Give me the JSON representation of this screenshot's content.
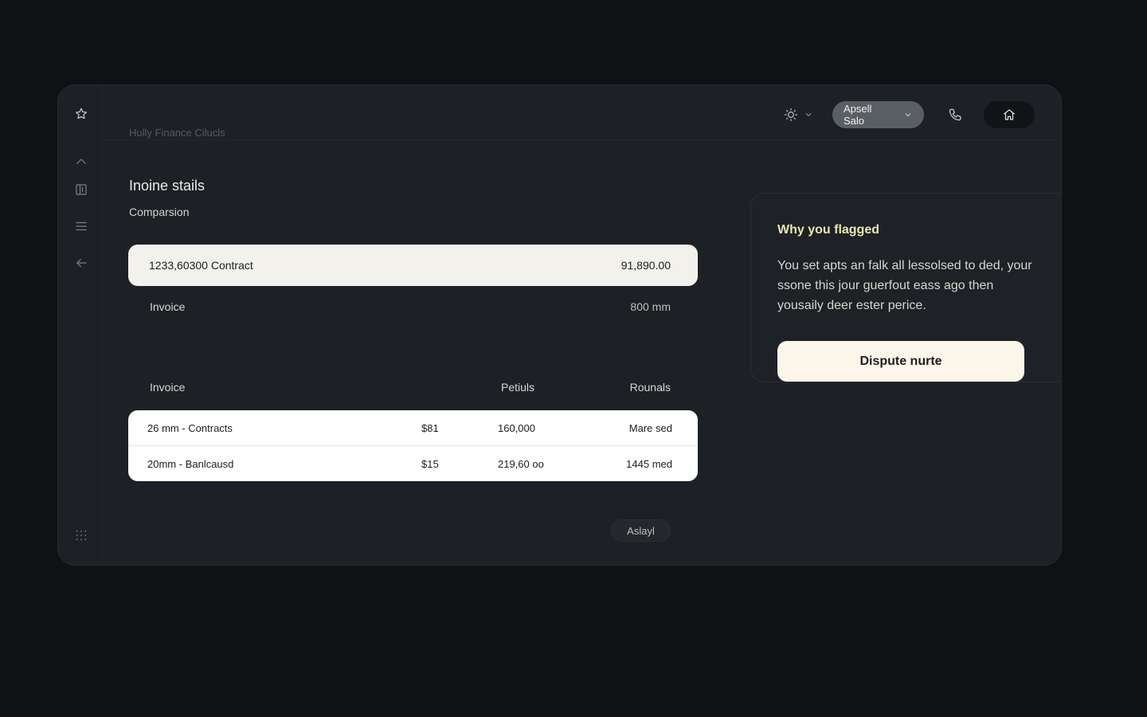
{
  "app": {
    "brand": "Hully Finance Cilucls"
  },
  "header": {
    "user_name": "Apsell Salo"
  },
  "main": {
    "title": "Inoine stails",
    "subtitle": "Comparsion",
    "summary": {
      "label": "1233,60300 Contract",
      "value": "91,890.00"
    },
    "invoice_row": {
      "label": "Invoice",
      "value": "800 mm"
    },
    "table": {
      "headers": [
        "Invoice",
        "Petiuls",
        "Rounals"
      ],
      "rows": [
        [
          "26 mm - Contracts",
          "$81",
          "160,000",
          "Mare sed"
        ],
        [
          "20mm - Banlcausd",
          "$15",
          "219,60 oo",
          "1445 med"
        ]
      ]
    },
    "assign_label": "Aslayl"
  },
  "flag_panel": {
    "title": "Why you flagged",
    "body": "You set apts an falk all lessolsed to ded, your ssone this jour guerfout eass ago then yousaily deer ester perice.",
    "button_label": "Dispute nurte"
  },
  "colors": {
    "background": "#0f1114",
    "window": "#1d2125",
    "accent_title": "#ece5b0",
    "primary_button": "#fcf6ea"
  },
  "icons": {
    "sidebar": [
      "star-icon",
      "chevron-up-icon",
      "columns-icon",
      "menu-icon",
      "arrow-left-icon",
      "grid-icon"
    ],
    "header": [
      "sun-icon",
      "chevron-down-icon",
      "phone-icon",
      "home-icon"
    ]
  }
}
